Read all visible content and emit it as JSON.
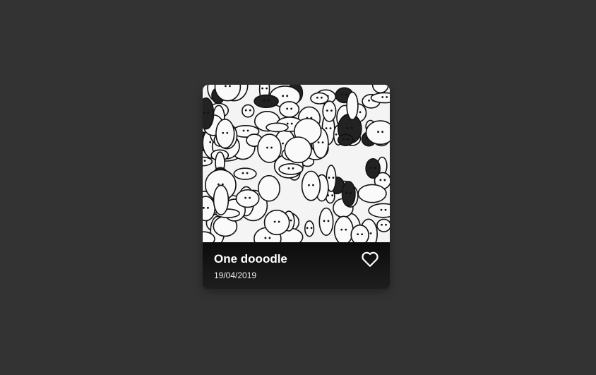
{
  "card": {
    "title": "One dooodle",
    "date": "19/04/2019",
    "image_alt": "doodle illustration",
    "icon": "heart-icon"
  }
}
